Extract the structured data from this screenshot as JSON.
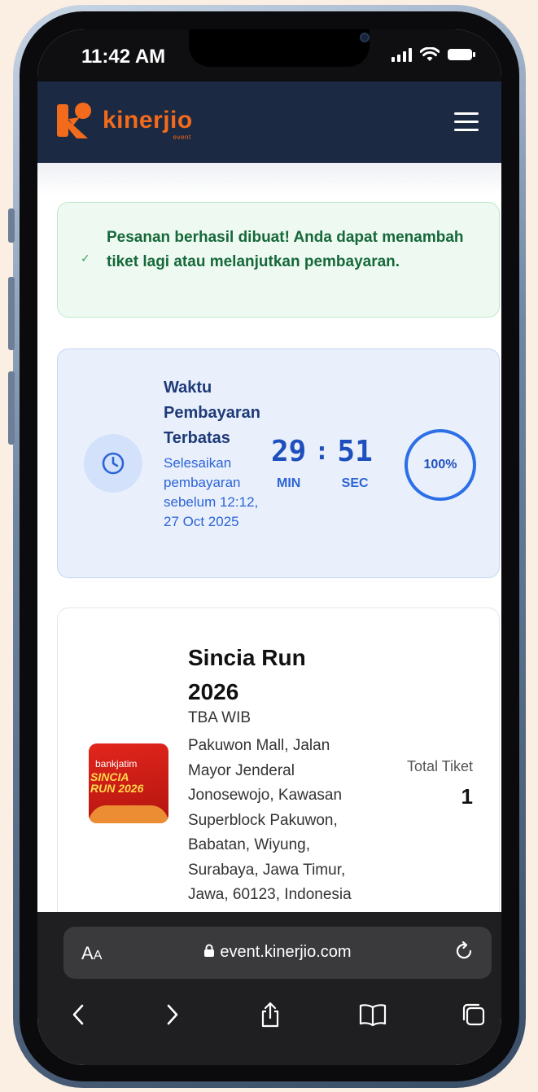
{
  "status_bar": {
    "time": "11:42 AM",
    "icons": [
      "cellular-icon",
      "wifi-icon",
      "battery-icon"
    ]
  },
  "header": {
    "brand": "kinerjio",
    "brand_sub": "event",
    "menu_icon": "hamburger-menu-icon",
    "background": "#1b2942",
    "brand_color": "#f26a1b"
  },
  "alert": {
    "icon": "check-icon",
    "message": "Pesanan berhasil dibuat! Anda dapat menambah tiket lagi atau melanjutkan pembayaran."
  },
  "payment_timer": {
    "icon": "clock-icon",
    "title": "Waktu Pembayaran Terbatas",
    "subtitle": "Selesaikan pembayaran sebelum 12:12, 27 Oct 2025",
    "minutes": "29",
    "separator": ":",
    "seconds": "51",
    "minutes_label": "MIN",
    "seconds_label": "SEC",
    "progress_label": "100%",
    "progress_value": 1.0
  },
  "event": {
    "name": "Sincia Run 2026",
    "time": "TBA WIB",
    "address": "Pakuwon Mall, Jalan Mayor Jenderal Jonosewojo, Kawasan Superblock Pakuwon, Babatan, Wiyung, Surabaya, Jawa Timur, Jawa, 60123, Indonesia",
    "total_tiket_label": "Total Tiket",
    "total_tiket_value": "1",
    "thumb_top": "bankjatim",
    "thumb_mid_1": "SINCIA",
    "thumb_mid_2": "RUN 2026"
  },
  "browser": {
    "aa_label_big": "A",
    "aa_label_small": "A",
    "url": "event.kinerjio.com",
    "nav": [
      "back-icon",
      "forward-icon",
      "share-icon",
      "bookmarks-icon",
      "tabs-icon"
    ]
  }
}
